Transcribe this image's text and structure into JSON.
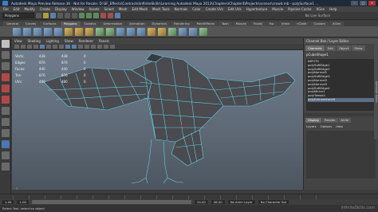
{
  "window": {
    "title": "Autodesk Maya Preview Release 36 - Not for Resale: D:\\SF_Effects\\Contracts\\InfiniteSkills\\Learning Autodesk Maya 2013\\Chapters\\Chapter4\\Projects\\scenes\\crowd.mb - polySurface1 ..."
  },
  "menubar": [
    "File",
    "Edit",
    "Modify",
    "Create",
    "Display",
    "Window",
    "Assets",
    "Select",
    "Mesh",
    "Edit Mesh",
    "Mesh Tools",
    "Normals",
    "Color",
    "Create UVs",
    "Edit UVs",
    "Hypertexture",
    "Muscle",
    "Pipeline Cache",
    "XGen",
    "Help"
  ],
  "statusline": {
    "mode": "Polygons",
    "live_surface": "No Live Surface"
  },
  "shelf_tabs": [
    "General",
    "Curves",
    "Surfaces",
    "Polygons",
    "Subdivs",
    "Deformation",
    "Animation",
    "Dynamics",
    "Rendering",
    "PaintEffects",
    "Toon",
    "Muscle",
    "Fluids",
    "Fur",
    "nHair",
    "nCloth",
    "Custom",
    "XGen"
  ],
  "shelf_active": "Polygons",
  "viewport": {
    "menu": [
      "View",
      "Shading",
      "Lighting",
      "Show",
      "Renderer",
      "Panels"
    ],
    "hud": {
      "headers": [
        "",
        "",
        "",
        ""
      ],
      "rows": [
        {
          "label": "Verts:",
          "v1": "438",
          "v2": "438",
          "v3": "0"
        },
        {
          "label": "Edges:",
          "v1": "876",
          "v2": "876",
          "v3": "0"
        },
        {
          "label": "Faces:",
          "v1": "440",
          "v2": "440",
          "v3": "0"
        },
        {
          "label": "Tris:",
          "v1": "876",
          "v2": "876",
          "v3": "0"
        },
        {
          "label": "UVs:",
          "v1": "480",
          "v2": "480",
          "v3": "0"
        }
      ]
    }
  },
  "right_panel": {
    "header": "Channel Box / Layer Editor",
    "tabs": [
      "Channels",
      "Edit",
      "Object",
      "Show"
    ],
    "node_title": "pCubeShape1",
    "node_section": "INPUTS",
    "nodes": [
      "polySoftEdge1",
      "polySoftEdge2",
      "polyNormal1",
      "polySoftEdge3",
      "polyNormal2",
      "polyNormal3",
      "polySoftEdge4",
      "polyMirror1",
      "polyTweak1",
      "polyExtrudeFace6"
    ],
    "layer_tabs": [
      "Display",
      "Render",
      "Anim"
    ],
    "layer_menu": [
      "Layers",
      "Options",
      "Help"
    ],
    "side_tab": "Attribute Editor"
  },
  "range": {
    "start": "1.00",
    "inner_start": "1.00",
    "inner_end": "24.00",
    "end": "48.00",
    "anim_layer": "No Anim Layer",
    "char_set": "No Character Set"
  },
  "helpline": "Select Tool: select an object",
  "watermark": "InfiniteSkills.com",
  "colors": {
    "wire": "#5fd0e8",
    "model": "#4b4b4f",
    "background": "#5d6874"
  }
}
